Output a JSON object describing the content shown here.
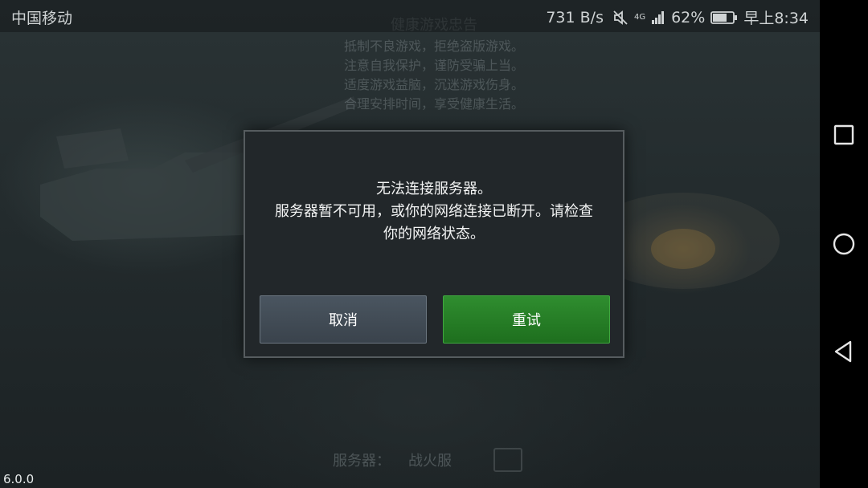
{
  "status_bar": {
    "carrier": "中国移动",
    "net_speed": "731 B/s",
    "network_type": "4G",
    "battery": "62%",
    "time": "早上8:34",
    "icons": [
      "mute-icon",
      "signal-icon",
      "battery-icon"
    ]
  },
  "health_notice": {
    "title": "健康游戏忠告",
    "lines": [
      "抵制不良游戏，拒绝盗版游戏。",
      "注意自我保护，谨防受骗上当。",
      "适度游戏益脑，沉迷游戏伤身。",
      "合理安排时间，享受健康生活。"
    ]
  },
  "dialog": {
    "message": "无法连接服务器。\n服务器暂不可用，或你的网络连接已断开。请检查\n你的网络状态。",
    "cancel_label": "取消",
    "retry_label": "重试"
  },
  "server": {
    "label": "服务器：",
    "name": "战火服"
  },
  "version": "6.0.0",
  "nav_bar": {
    "icons": [
      "recent-apps-icon",
      "home-icon",
      "back-icon"
    ]
  },
  "colors": {
    "retry_button": "#2a862a",
    "cancel_button": "#434d57",
    "dialog_bg": "#22272a",
    "nav_bg": "#000000"
  }
}
